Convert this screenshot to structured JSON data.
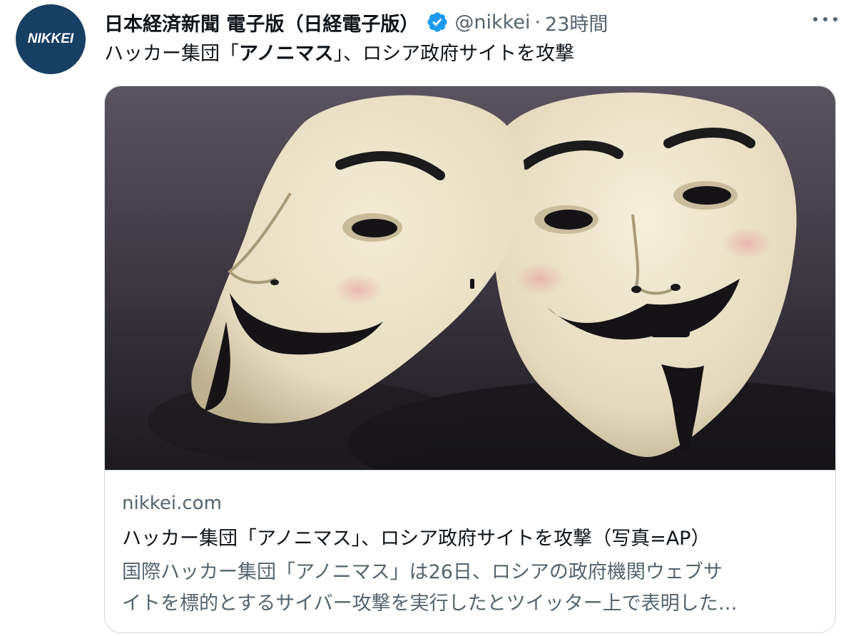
{
  "author": {
    "avatar_text": "NIKKEI",
    "name": "日本経済新聞 電子版（日経電子版）",
    "handle": "@nikkei",
    "separator": "·",
    "timestamp": "23時間",
    "verified": true
  },
  "tweet": {
    "text_before": "ハッカー集団「",
    "text_bold": "アノニマス",
    "text_after": "」、ロシア政府サイトを攻撃"
  },
  "card": {
    "image_icon": "anonymous-masks-photo",
    "domain": "nikkei.com",
    "title": "ハッカー集団「アノニマス」、ロシア政府サイトを攻撃（写真=AP）",
    "description_line1": "国際ハッカー集団「アノニマス」は26日、ロシアの政府機関ウェブサ",
    "description_line2": "イトを標的とするサイバー攻撃を実行したとツイッター上で表明した…"
  },
  "colors": {
    "avatar_bg": "#173f64",
    "verified_blue": "#1d9bf0",
    "secondary_text": "#536471",
    "border": "#cfd9de"
  }
}
